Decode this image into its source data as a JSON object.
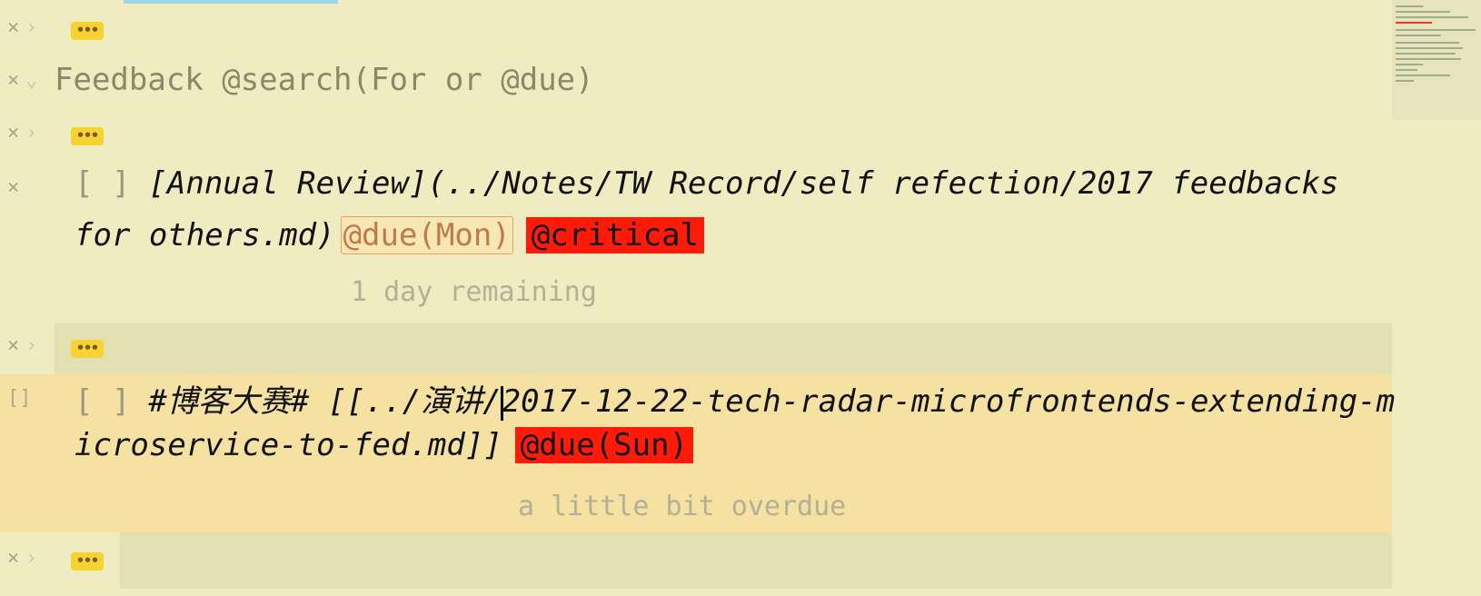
{
  "rows": {
    "fold1": {
      "x": "×",
      "chevron": "›",
      "ellipsis": "•••"
    },
    "search": {
      "x": "×",
      "chevron": "⌄",
      "text": "Feedback @search(For or @due)"
    },
    "fold2": {
      "x": "×",
      "chevron": "›",
      "ellipsis": "•••"
    },
    "task1": {
      "x": "×",
      "checkbox": "[ ]",
      "line1": "[Annual Review](../Notes/TW Record/self refection/2017 feedbacks",
      "line2": "for others.md)",
      "due_tag": "@due(Mon)",
      "priority_tag": "@critical",
      "hint": "1 day remaining"
    },
    "fold3": {
      "x": "×",
      "chevron": "›",
      "ellipsis": "•••"
    },
    "task2": {
      "gutter": "[]",
      "checkbox": "[ ]",
      "line1_before_cursor": "#博客大赛# [[../演讲/",
      "line1_after_cursor": "2017-12-22-tech-radar-microfrontends-extending-m",
      "line2": "icroservice-to-fed.md]]",
      "due_tag": "@due(Sun)",
      "hint": "a little bit overdue"
    },
    "fold4": {
      "x": "×",
      "chevron": "›",
      "ellipsis": "•••"
    }
  },
  "colors": {
    "background": "#f0ecc1",
    "current_line": "#f5e2a3",
    "fold_pill": "#f6d233",
    "critical_tag": "#ff1a0a",
    "due_tag_border": "#e4a35a"
  }
}
